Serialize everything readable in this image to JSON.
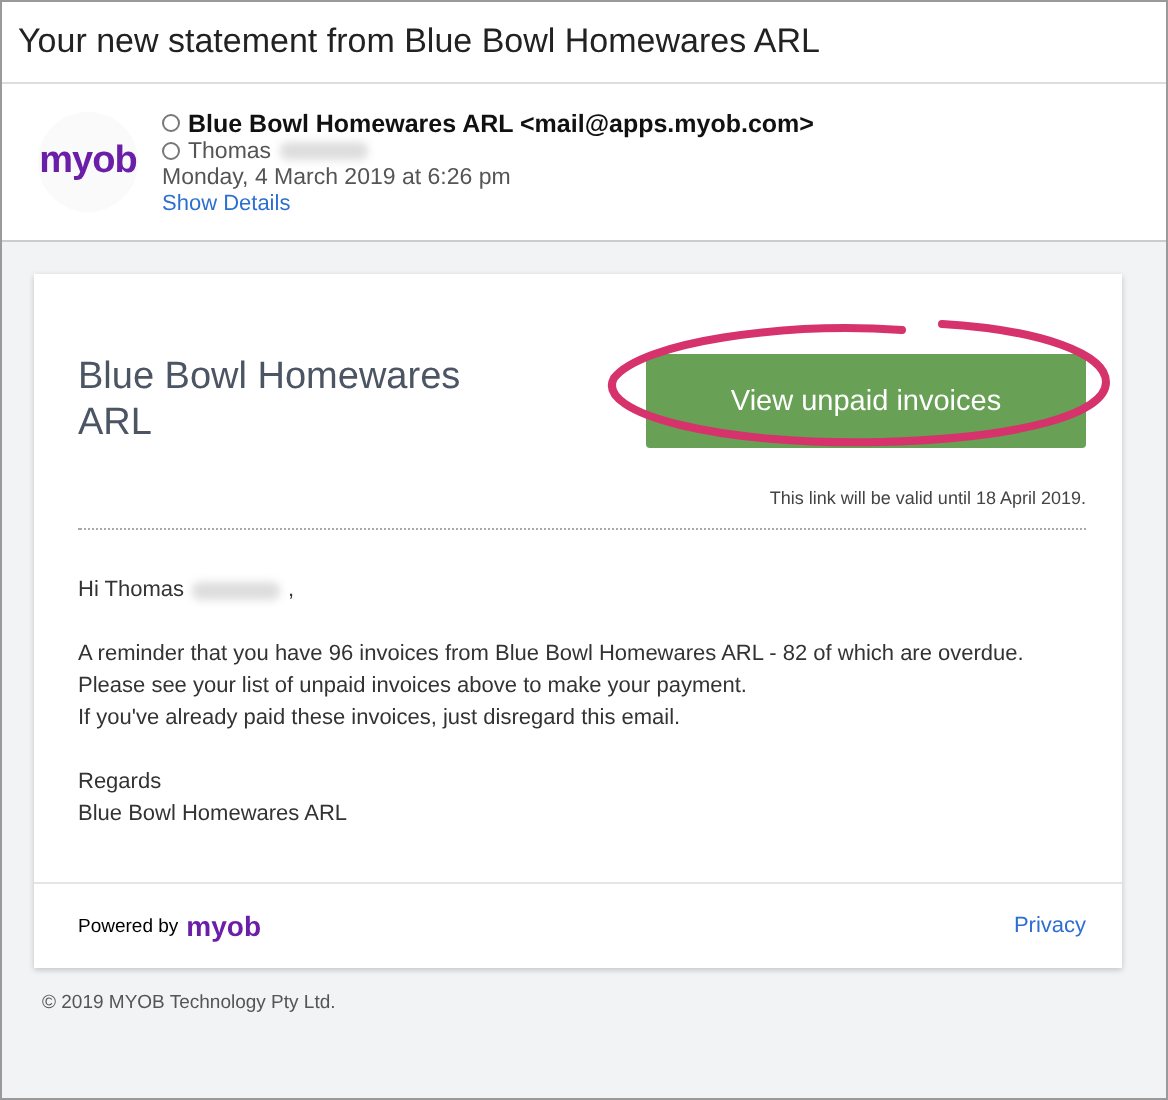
{
  "subject": "Your new statement from Blue Bowl Homewares ARL",
  "header": {
    "logo": "myob",
    "from": "Blue Bowl Homewares ARL <mail@apps.myob.com>",
    "to": "Thomas",
    "date": "Monday, 4 March 2019 at 6:26 pm",
    "details_link": "Show Details"
  },
  "email": {
    "company": "Blue Bowl Homewares ARL",
    "button": "View unpaid invoices",
    "button_circled": true,
    "validity": "This link will be valid until 18 April 2019.",
    "greeting": "Hi Thomas",
    "greeting_end": ",",
    "body": [
      "A reminder that you have 96 invoices from Blue Bowl Homewares ARL - 82 of which are overdue.",
      "Please see your list of unpaid invoices above to make your payment.",
      "If you've already paid these invoices, just disregard this email."
    ],
    "signoff": [
      "Regards",
      "Blue Bowl Homewares ARL"
    ],
    "powered_by": "Powered by",
    "powered_logo": "myob",
    "privacy": "Privacy"
  },
  "copyright": "© 2019 MYOB Technology Pty Ltd."
}
